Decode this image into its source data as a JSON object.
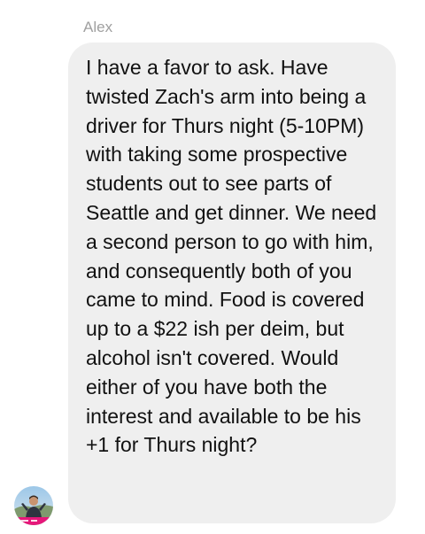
{
  "conversation": {
    "sender_name": "Alex",
    "message": {
      "text": "I have a favor to ask. Have twisted Zach's arm into being a driver for Thurs night (5-10PM) with taking some prospective students out to see parts of Seattle and get dinner. We need a second person to go with him, and consequently both of you came to mind. Food is covered up to a $22 ish per deim, but alcohol isn't covered. Would either of you have both the interest and available to be his +1 for Thurs night?"
    },
    "avatar": {
      "icon": "user-photo-avatar",
      "accent_color": "#e6177a"
    }
  }
}
